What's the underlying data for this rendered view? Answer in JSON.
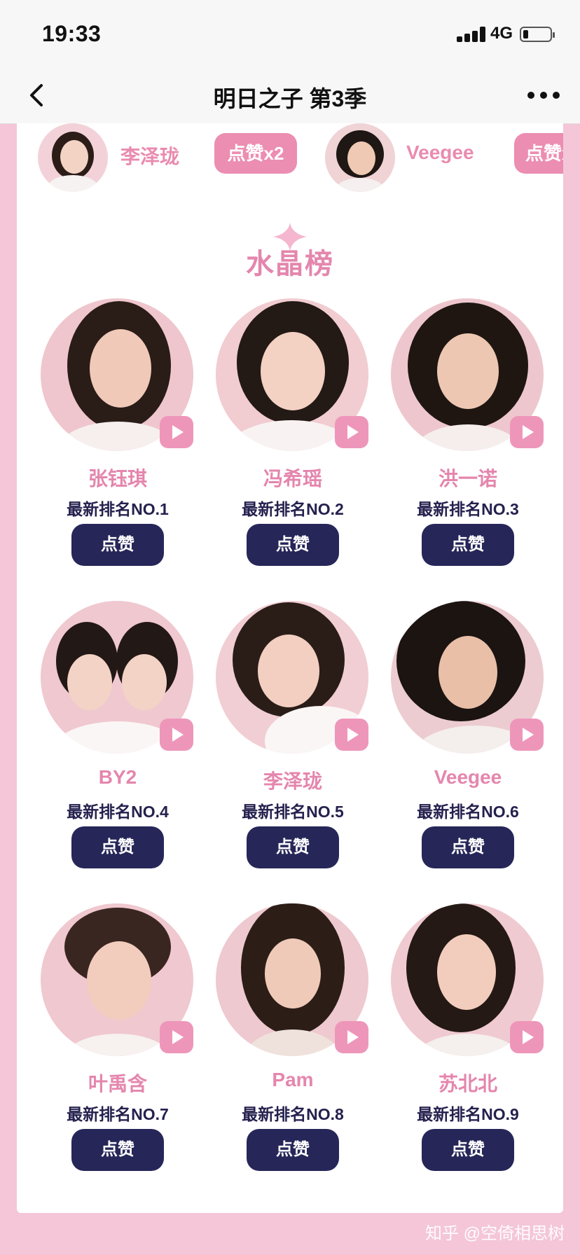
{
  "status_bar": {
    "time": "19:33",
    "network": "4G"
  },
  "nav": {
    "title": "明日之子 第3季"
  },
  "like_bar": {
    "items": [
      {
        "name": "李泽珑",
        "button": "点赞x2"
      },
      {
        "name": "Veegee",
        "button": "点赞x"
      }
    ]
  },
  "section": {
    "title": "水晶榜"
  },
  "contestants": [
    {
      "name": "张钰琪",
      "rank": "最新排名NO.1",
      "button": "点赞"
    },
    {
      "name": "冯希瑶",
      "rank": "最新排名NO.2",
      "button": "点赞"
    },
    {
      "name": "洪一诺",
      "rank": "最新排名NO.3",
      "button": "点赞"
    },
    {
      "name": "BY2",
      "rank": "最新排名NO.4",
      "button": "点赞"
    },
    {
      "name": "李泽珑",
      "rank": "最新排名NO.5",
      "button": "点赞"
    },
    {
      "name": "Veegee",
      "rank": "最新排名NO.6",
      "button": "点赞"
    },
    {
      "name": "叶禹含",
      "rank": "最新排名NO.7",
      "button": "点赞"
    },
    {
      "name": "Pam",
      "rank": "最新排名NO.8",
      "button": "点赞"
    },
    {
      "name": "苏北北",
      "rank": "最新排名NO.9",
      "button": "点赞"
    }
  ],
  "watermark": "知乎 @空倚相思树",
  "colors": {
    "page_bg": "#f4c6d7",
    "accent_pink": "#ec8db2",
    "name_pink": "#e486ad",
    "button_navy": "#262659"
  }
}
